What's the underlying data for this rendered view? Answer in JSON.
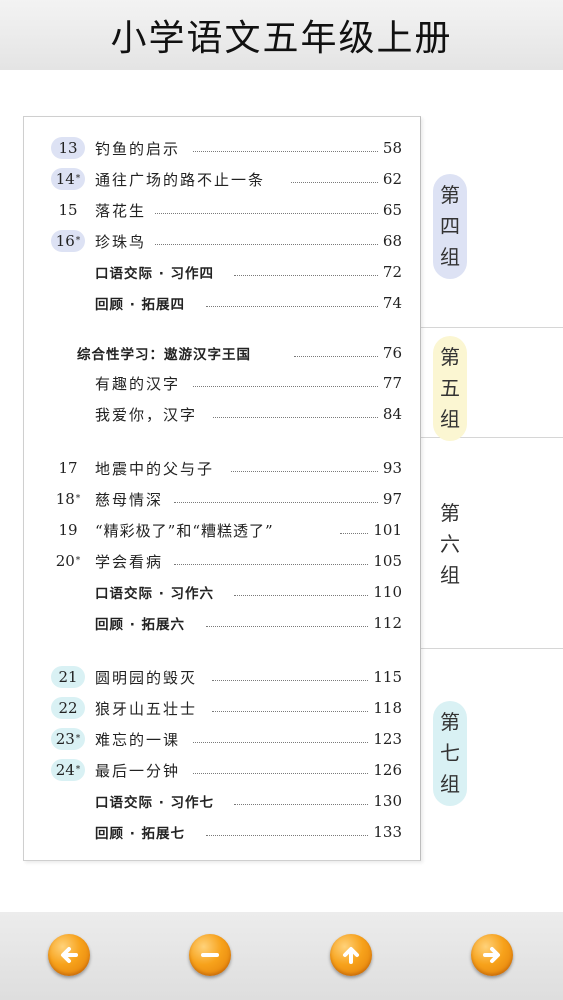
{
  "header": {
    "title": "小学语文五年级上册"
  },
  "toc": {
    "group4": {
      "label": "第四组",
      "color": "#dde2f4",
      "entries": [
        {
          "num": "13",
          "star": "",
          "title": "钓鱼的启示",
          "page": "58",
          "num_bg": "#dde2f4"
        },
        {
          "num": "14",
          "star": "*",
          "title": "通往广场的路不止一条",
          "page": "62",
          "num_bg": "#dde2f4"
        },
        {
          "num": "15",
          "star": "",
          "title": "落花生",
          "page": "65",
          "num_bg": ""
        },
        {
          "num": "16",
          "star": "*",
          "title": "珍珠鸟",
          "page": "68",
          "num_bg": "#dde2f4"
        },
        {
          "num": "",
          "star": "",
          "title": "口语交际 · 习作四",
          "page": "72",
          "num_bg": ""
        },
        {
          "num": "",
          "star": "",
          "title": "回顾 · 拓展四",
          "page": "74",
          "num_bg": ""
        }
      ]
    },
    "group5": {
      "label": "第五组",
      "color": "#fbf6d2",
      "entries": [
        {
          "title": "综合性学习：遨游汉字王国",
          "page": "76"
        },
        {
          "title": "有趣的汉字",
          "page": "77"
        },
        {
          "title": "我爱你，汉字",
          "page": "84"
        }
      ]
    },
    "group6": {
      "label": "第六组",
      "color": "#ffffff",
      "entries": [
        {
          "num": "17",
          "star": "",
          "title": "地震中的父与子",
          "page": "93"
        },
        {
          "num": "18",
          "star": "*",
          "title": "慈母情深",
          "page": "97"
        },
        {
          "num": "19",
          "star": "",
          "title": "“精彩极了”和“糟糕透了”",
          "page": "101"
        },
        {
          "num": "20",
          "star": "*",
          "title": "学会看病",
          "page": "105"
        },
        {
          "num": "",
          "star": "",
          "title": "口语交际 · 习作六",
          "page": "110"
        },
        {
          "num": "",
          "star": "",
          "title": "回顾 · 拓展六",
          "page": "112"
        }
      ]
    },
    "group7": {
      "label": "第七组",
      "color": "#d9f1f4",
      "entries": [
        {
          "num": "21",
          "star": "",
          "title": "圆明园的毁灭",
          "page": "115",
          "num_bg": "#d9f1f4"
        },
        {
          "num": "22",
          "star": "",
          "title": "狼牙山五壮士",
          "page": "118",
          "num_bg": "#d9f1f4"
        },
        {
          "num": "23",
          "star": "*",
          "title": "难忘的一课",
          "page": "123",
          "num_bg": "#d9f1f4"
        },
        {
          "num": "24",
          "star": "*",
          "title": "最后一分钟",
          "page": "126",
          "num_bg": "#d9f1f4"
        },
        {
          "num": "",
          "star": "",
          "title": "口语交际 · 习作七",
          "page": "130",
          "num_bg": ""
        },
        {
          "num": "",
          "star": "",
          "title": "回顾 · 拓展七",
          "page": "133",
          "num_bg": ""
        }
      ]
    }
  },
  "nav": {
    "buttons": [
      {
        "icon": "arrow-left-icon"
      },
      {
        "icon": "minus-icon"
      },
      {
        "icon": "arrow-up-icon"
      },
      {
        "icon": "arrow-right-icon"
      }
    ]
  }
}
